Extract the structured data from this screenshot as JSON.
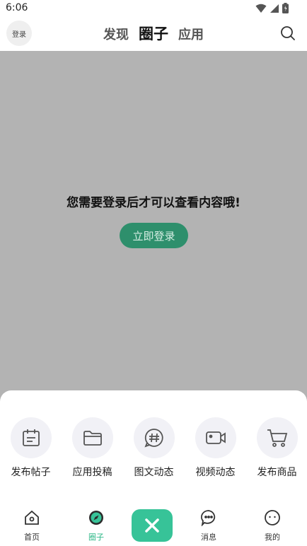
{
  "status_bar": {
    "time": "6:06"
  },
  "header": {
    "login_badge": "登录",
    "tabs": [
      {
        "label": "发现"
      },
      {
        "label": "圈子"
      },
      {
        "label": "应用"
      }
    ]
  },
  "main": {
    "message": "您需要登录后才可以查看内容哦!",
    "login_button": "立即登录"
  },
  "publish_sheet": {
    "actions": [
      {
        "label": "发布帖子",
        "icon": "calendar-icon"
      },
      {
        "label": "应用投稿",
        "icon": "folder-icon"
      },
      {
        "label": "图文动态",
        "icon": "hashtag-chat-icon"
      },
      {
        "label": "视频动态",
        "icon": "video-camera-icon"
      },
      {
        "label": "发布商品",
        "icon": "shopping-cart-icon"
      }
    ]
  },
  "bottom_nav": {
    "items": [
      {
        "label": "首页"
      },
      {
        "label": "圈子"
      },
      {
        "label": "消息"
      },
      {
        "label": "我的"
      }
    ],
    "active_color": "#2fb888",
    "fab_color": "#37c398"
  }
}
